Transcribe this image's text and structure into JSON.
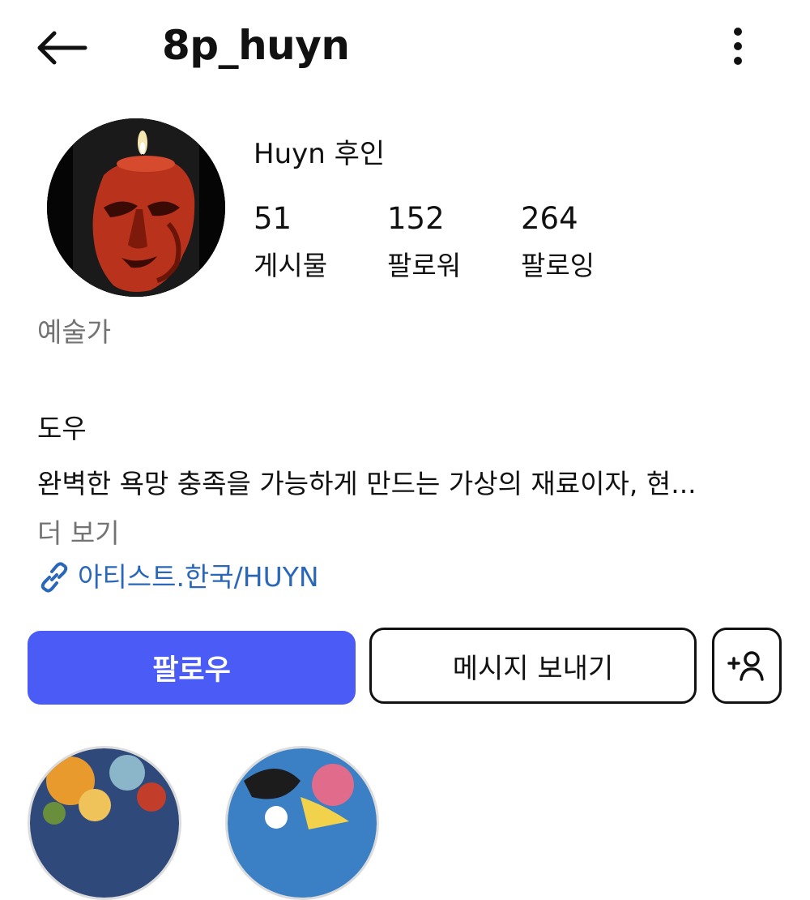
{
  "header": {
    "back_icon": "arrow-left-icon",
    "username": "8p_huyn",
    "more_icon": "more-vertical-icon"
  },
  "profile": {
    "avatar_icon": "candle-face-avatar",
    "display_name": "Huyn 후인",
    "stats": [
      {
        "value": "51",
        "label": "게시물"
      },
      {
        "value": "152",
        "label": "팔로워"
      },
      {
        "value": "264",
        "label": "팔로잉"
      }
    ],
    "category": "예술가",
    "bio_name": "도우",
    "bio_text": "완벽한 욕망 충족을 가능하게 만드는 가상의 재료이자, 현...",
    "more_label": "더 보기",
    "website_icon": "link-icon",
    "website": "아티스트.한국/HUYN"
  },
  "actions": {
    "follow_label": "팔로우",
    "message_label": "메시지 보내기",
    "add_user_icon": "add-user-icon"
  },
  "colors": {
    "accent": "#4a5cf5",
    "link": "#2a67b8",
    "muted": "#737373"
  }
}
